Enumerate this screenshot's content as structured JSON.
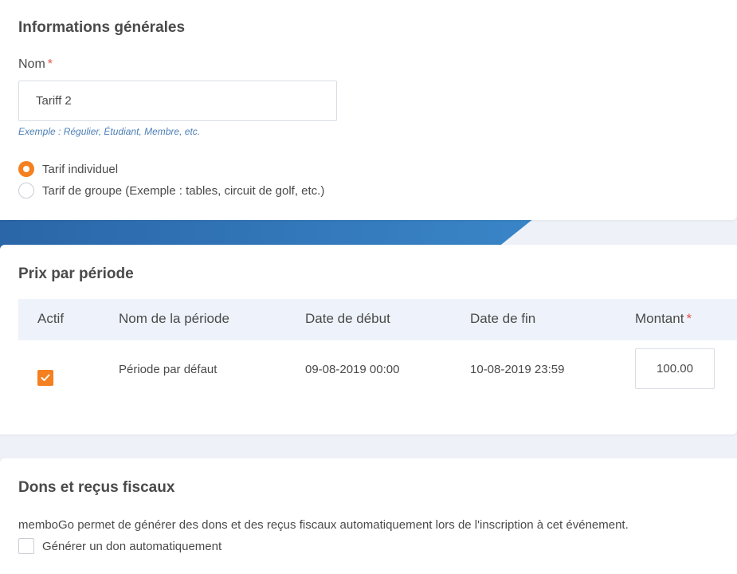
{
  "general": {
    "title": "Informations générales",
    "name_label": "Nom",
    "required_mark": "*",
    "name_value": "Tariff 2",
    "name_hint": "Exemple : Régulier, Étudiant, Membre, etc.",
    "radio_options": [
      {
        "label": "Tarif individuel",
        "checked": true
      },
      {
        "label": "Tarif de groupe (Exemple : tables, circuit de golf, etc.)",
        "checked": false
      }
    ]
  },
  "periods": {
    "title": "Prix par période",
    "columns": {
      "active": "Actif",
      "name": "Nom de la période",
      "start": "Date de début",
      "end": "Date de fin",
      "amount": "Montant"
    },
    "required_mark": "*",
    "rows": [
      {
        "active": true,
        "name": "Période par défaut",
        "start": "09-08-2019 00:00",
        "end": "10-08-2019 23:59",
        "amount": "100.00"
      }
    ]
  },
  "donations": {
    "title": "Dons et reçus fiscaux",
    "description": "memboGo permet de générer des dons et des reçus fiscaux automatiquement lors de l'inscription à cet événement.",
    "auto_donation_label": "Générer un don automatiquement",
    "auto_donation_checked": false
  },
  "colors": {
    "accent": "#f5801f",
    "band_blue": "#2f74b8",
    "hint_blue": "#4d7fb5",
    "required_red": "#e5534b"
  }
}
